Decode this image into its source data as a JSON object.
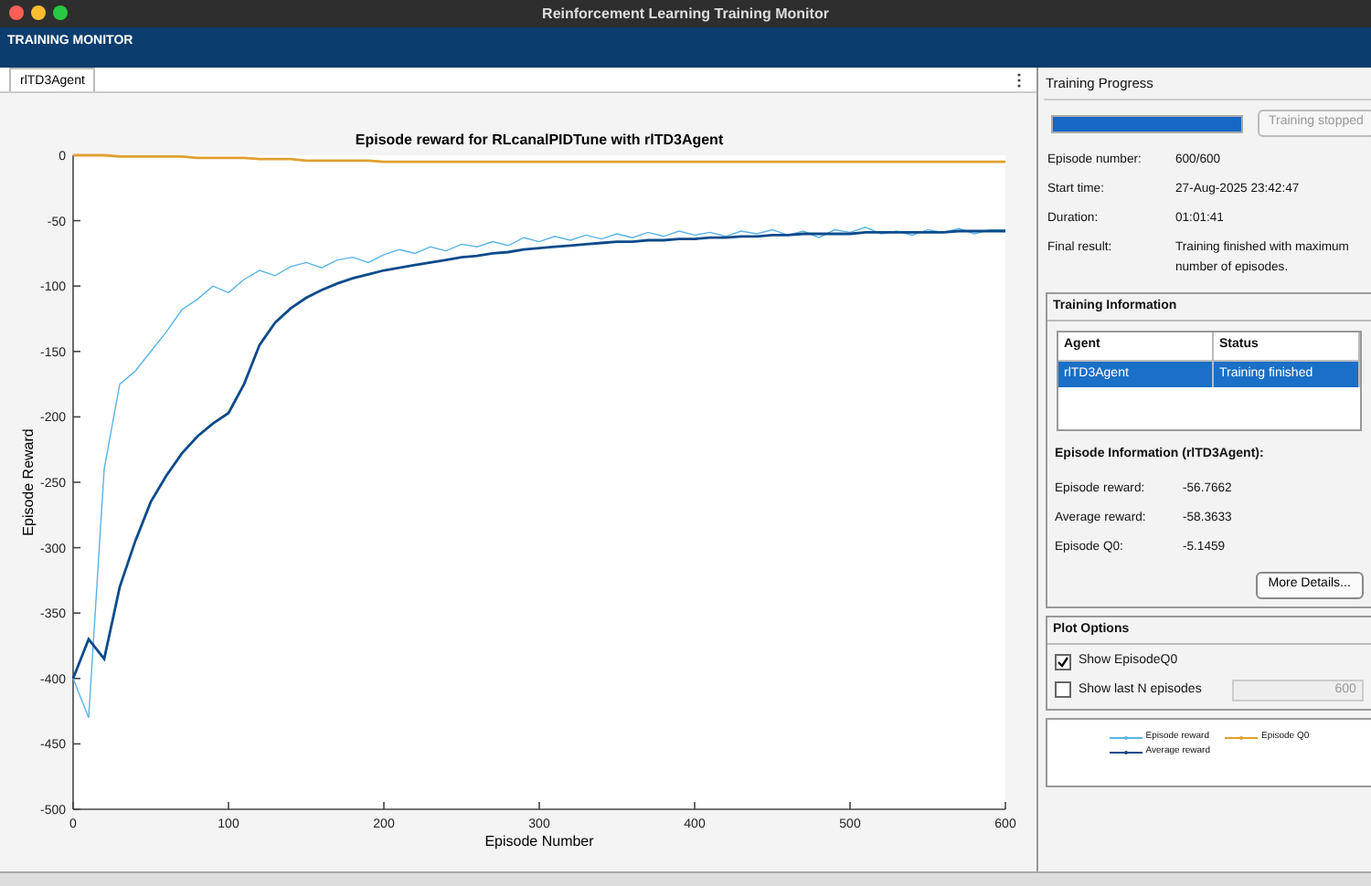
{
  "window": {
    "title": "Reinforcement Learning Training Monitor"
  },
  "toolstrip": {
    "title": "TRAINING MONITOR"
  },
  "document_tabs": [
    {
      "label": "rlTD3Agent",
      "selected": true
    }
  ],
  "plot": {
    "chart_data": {
      "type": "line",
      "title": "Episode reward for RLcanalPIDTune with rlTD3Agent",
      "xlabel": "Episode Number",
      "ylabel": "Episode Reward",
      "x": [
        0,
        10,
        20,
        30,
        40,
        50,
        60,
        70,
        80,
        90,
        100,
        110,
        120,
        130,
        140,
        150,
        160,
        170,
        180,
        190,
        200,
        210,
        220,
        230,
        240,
        250,
        260,
        270,
        280,
        290,
        300,
        310,
        320,
        330,
        340,
        350,
        360,
        370,
        380,
        390,
        400,
        410,
        420,
        430,
        440,
        450,
        460,
        470,
        480,
        490,
        500,
        510,
        520,
        530,
        540,
        550,
        560,
        570,
        580,
        590,
        600
      ],
      "series": [
        {
          "name": "Episode reward",
          "color": "#5ab4e6",
          "values": [
            -400,
            -430,
            -240,
            -175,
            -165,
            -150,
            -135,
            -118,
            -110,
            -100,
            -105,
            -95,
            -88,
            -92,
            -85,
            -82,
            -86,
            -80,
            -78,
            -82,
            -76,
            -72,
            -75,
            -70,
            -73,
            -68,
            -70,
            -66,
            -69,
            -63,
            -66,
            -62,
            -65,
            -61,
            -64,
            -60,
            -63,
            -59,
            -62,
            -58,
            -61,
            -59,
            -62,
            -58,
            -60,
            -57,
            -61,
            -58,
            -63,
            -57,
            -59,
            -55,
            -60,
            -58,
            -61,
            -57,
            -59,
            -56,
            -60,
            -57,
            -57
          ]
        },
        {
          "name": "Average reward",
          "color": "#0b4a8b",
          "values": [
            -400,
            -370,
            -385,
            -330,
            -295,
            -265,
            -245,
            -228,
            -215,
            -205,
            -197,
            -175,
            -145,
            -128,
            -117,
            -109,
            -103,
            -98,
            -94,
            -91,
            -88,
            -86,
            -84,
            -82,
            -80,
            -78,
            -77,
            -75,
            -74,
            -72,
            -71,
            -70,
            -69,
            -68,
            -67,
            -66,
            -66,
            -65,
            -65,
            -64,
            -64,
            -63,
            -63,
            -62,
            -62,
            -61,
            -61,
            -60,
            -60,
            -60,
            -60,
            -59,
            -59,
            -59,
            -59,
            -59,
            -59,
            -58,
            -58,
            -58,
            -58
          ]
        },
        {
          "name": "Episode Q0",
          "color": "#e0a030",
          "values": [
            0,
            0,
            0,
            -1,
            -1,
            -1,
            -1,
            -1,
            -2,
            -2,
            -2,
            -2,
            -3,
            -3,
            -3,
            -4,
            -4,
            -4,
            -4,
            -4,
            -5,
            -5,
            -5,
            -5,
            -5,
            -5,
            -5,
            -5,
            -5,
            -5,
            -5,
            -5,
            -5,
            -5,
            -5,
            -5,
            -5,
            -5,
            -5,
            -5,
            -5,
            -5,
            -5,
            -5,
            -5,
            -5,
            -5,
            -5,
            -5,
            -5,
            -5,
            -5,
            -5,
            -5,
            -5,
            -5,
            -5,
            -5,
            -5,
            -5,
            -5
          ]
        }
      ],
      "xlim": [
        0,
        600
      ],
      "ylim": [
        -500,
        0
      ],
      "xticks": [
        0,
        100,
        200,
        300,
        400,
        500,
        600
      ],
      "yticks": [
        -500,
        -450,
        -400,
        -350,
        -300,
        -250,
        -200,
        -150,
        -100,
        -50,
        0
      ]
    }
  },
  "training_progress": {
    "title": "Training Progress",
    "level": 1,
    "button": {
      "label": "Training stopped",
      "disabled": true
    },
    "fields": [
      {
        "label": "Episode number:",
        "value": "600/600"
      },
      {
        "label": "Start time:",
        "value": "27-Aug-2025 23:42:47"
      },
      {
        "label": "Duration:",
        "value": "01:01:41"
      },
      {
        "label": "Final result:",
        "value": "Training finished with maximum number of episodes."
      }
    ]
  },
  "training_information": {
    "title": "Training Information",
    "table": {
      "columns": [
        "Agent",
        "Status"
      ],
      "rows": [
        {
          "cells": [
            "rlTD3Agent",
            "Training finished"
          ],
          "selected": true
        }
      ]
    },
    "episode_information": {
      "title": "Episode Information (rlTD3Agent):",
      "fields": [
        {
          "label": "Episode reward:",
          "value": "-56.7662"
        },
        {
          "label": "Average reward:",
          "value": "-58.3633"
        },
        {
          "label": "Episode Q0:",
          "value": "-5.1459"
        }
      ]
    },
    "button": "More Details..."
  },
  "plot_options": {
    "title": "Plot Options",
    "options": [
      {
        "label": "Show EpisodeQ0",
        "checked": true
      },
      {
        "label": "Show last N episodes",
        "checked": false,
        "field": {
          "value": "600",
          "disabled": true
        }
      }
    ]
  }
}
